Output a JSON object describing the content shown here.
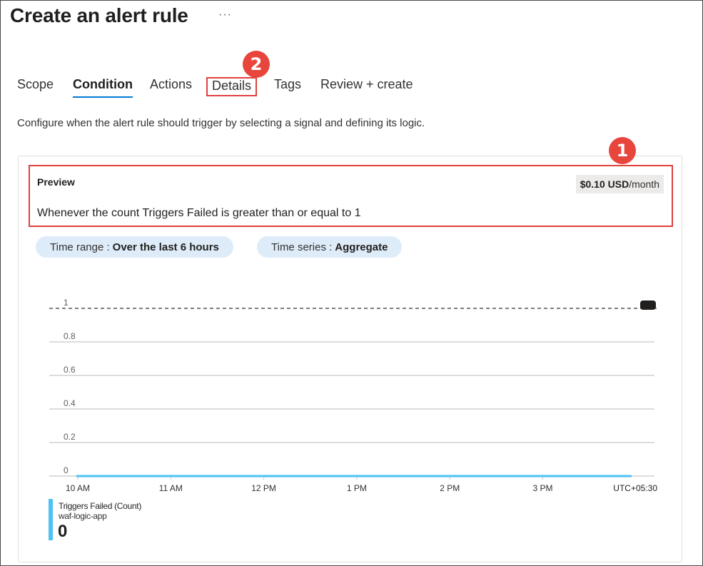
{
  "header": {
    "title": "Create an alert rule",
    "more": "···"
  },
  "tabs": [
    {
      "label": "Scope"
    },
    {
      "label": "Condition",
      "active": true
    },
    {
      "label": "Actions"
    },
    {
      "label": "Details",
      "highlighted": true
    },
    {
      "label": "Tags"
    },
    {
      "label": "Review + create"
    }
  ],
  "annotations": {
    "badge_1": "1",
    "badge_2": "2",
    "highlight_color": "#e0413f"
  },
  "description": "Configure when the alert rule should trigger by selecting a signal and defining its logic.",
  "preview": {
    "label": "Preview",
    "price_amount": "$0.10 USD",
    "price_unit": "/month",
    "condition": "Whenever the count Triggers Failed is greater than or equal to 1"
  },
  "filters": {
    "time_range_label": "Time range :",
    "time_range_value": "Over the last 6 hours",
    "time_series_label": "Time series :",
    "time_series_value": "Aggregate"
  },
  "chart_data": {
    "type": "line",
    "x": [
      "10 AM",
      "11 AM",
      "12 PM",
      "1 PM",
      "2 PM",
      "3 PM"
    ],
    "timezone": "UTC+05:30",
    "y_ticks": [
      "0",
      "0.2",
      "0.4",
      "0.6",
      "0.8",
      "1"
    ],
    "ylim": [
      0,
      1
    ],
    "threshold": 1,
    "series": [
      {
        "name": "Triggers Failed (Count)",
        "values": [
          0,
          0,
          0,
          0,
          0,
          0
        ],
        "color": "#4fc1f5"
      }
    ],
    "grid": true
  },
  "legend": {
    "name": "Triggers Failed (Count)",
    "resource": "waf-logic-app",
    "value": "0"
  }
}
